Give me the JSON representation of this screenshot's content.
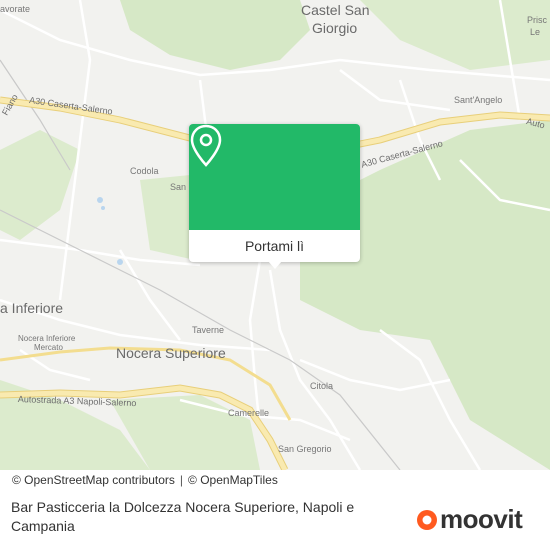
{
  "map": {
    "place_labels": {
      "castel_san_giorgio_1": "Castel San",
      "castel_san_giorgio_2": "Giorgio",
      "avorate": "avorate",
      "santangelo": "Sant'Angelo",
      "codola": "Codola",
      "san_partial": "San",
      "inferiore": "a Inferiore",
      "taverne": "Taverne",
      "nocera_superiore": "Nocera Superiore",
      "nocera_inferiore_mercato_1": "Nocera Inferiore",
      "nocera_inferiore_mercato_2": "Mercato",
      "citola": "Citola",
      "camerelle": "Camerelle",
      "san_gregorio": "San Gregorio",
      "prisc": "Prisc",
      "prisc_2": "Le",
      "fiano": "Fiano"
    },
    "road_labels": {
      "a30_left": "A30 Caserta-Salerno",
      "a30_right": "A30 Caserta-Salerno",
      "auto_right": "Auto",
      "a3": "Autostrada A3 Napoli-Salerno"
    },
    "colors": {
      "land": "#f2f2ef",
      "green": "#d6e8c6",
      "highway": "#f7e6a0",
      "road": "#ffffff",
      "accent": "#22b968"
    }
  },
  "popup": {
    "pin_icon": "location-pin-icon",
    "button_label": "Portami lì"
  },
  "attribution": {
    "osm": "© OpenStreetMap contributors",
    "separator": "|",
    "omt": "© OpenMapTiles"
  },
  "footer": {
    "caption": "Bar Pasticceria la Dolcezza Nocera Superiore, Napoli e Campania",
    "logo_text": "moovit",
    "logo_color": "#ff5a1f"
  }
}
